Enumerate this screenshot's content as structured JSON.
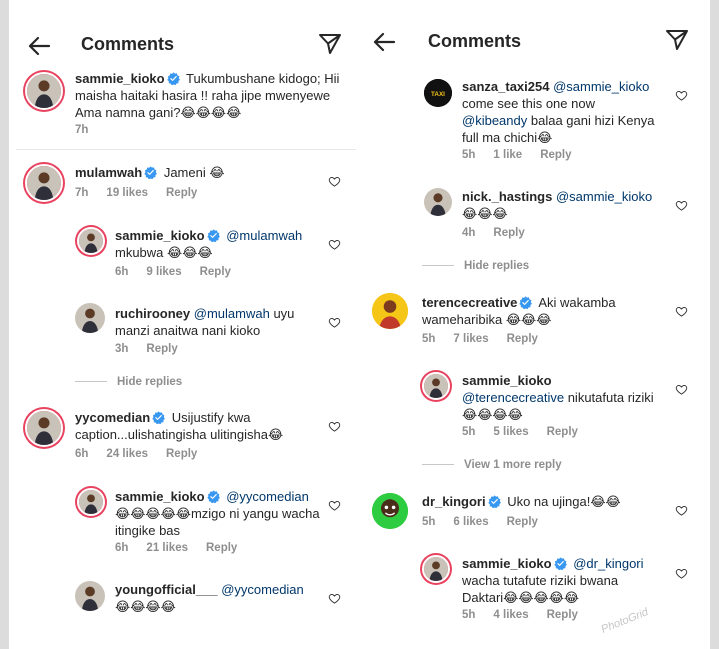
{
  "left": {
    "title": "Comments",
    "comments": [
      {
        "user": "sammie_kioko",
        "text": "Tukumbushane kidogo; Hii maisha haitaki hasira !! raha jipe mwenyewe Ama namna gani?😂😂😂😂",
        "time": "7h"
      },
      {
        "user": "mulamwah",
        "text": "Jameni 😂",
        "time": "7h",
        "likes": "19 likes",
        "reply": "Reply"
      },
      {
        "user": "sammie_kioko",
        "mention": "@mulamwah",
        "text": "mkubwa 😂😂😂",
        "time": "6h",
        "likes": "9 likes",
        "reply": "Reply"
      },
      {
        "user": "ruchirooney",
        "mention": "@mulamwah",
        "text": "uyu manzi anaitwa nani kioko",
        "time": "3h",
        "reply": "Reply"
      },
      {
        "hide": "Hide replies"
      },
      {
        "user": "yycomedian",
        "text": "Usijustify kwa caption...ulishatingisha ulitingisha😂",
        "time": "6h",
        "likes": "24 likes",
        "reply": "Reply"
      },
      {
        "user": "sammie_kioko",
        "mention": "@yycomedian",
        "text": "😂😂😂😂😂mzigo ni yangu wacha itingike bas",
        "time": "6h",
        "likes": "21 likes",
        "reply": "Reply"
      },
      {
        "user": "youngofficial___",
        "mention": "@yycomedian",
        "text": "😂😂😂😂"
      }
    ]
  },
  "right": {
    "title": "Comments",
    "comments": [
      {
        "user": "sanza_taxi254",
        "mention": "@sammie_kioko",
        "text": "come see this one now",
        "mention2": "@kibeandy",
        "text2": "balaa gani hizi Kenya full ma chichi😂",
        "time": "5h",
        "likes": "1 like",
        "reply": "Reply"
      },
      {
        "user": "nick._hastings",
        "mention": "@sammie_kioko",
        "text": "😂😂😂",
        "time": "4h",
        "reply": "Reply"
      },
      {
        "hide": "Hide replies"
      },
      {
        "user": "terencecreative",
        "text": "Aki wakamba wameharibika 😂😂😂",
        "time": "5h",
        "likes": "7 likes",
        "reply": "Reply"
      },
      {
        "user": "sammie_kioko",
        "mention": "@terencecreative",
        "text": "nikutafuta riziki😂😂😂😂",
        "time": "5h",
        "likes": "5 likes",
        "reply": "Reply"
      },
      {
        "more": "View 1 more reply"
      },
      {
        "user": "dr_kingori",
        "text": "Uko na ujinga!😂😂",
        "time": "5h",
        "likes": "6 likes",
        "reply": "Reply"
      },
      {
        "user": "sammie_kioko",
        "mention": "@dr_kingori",
        "text": "wacha tutafute riziki bwana Daktari😂😂😂😂😂",
        "time": "5h",
        "likes": "4 likes",
        "reply": "Reply"
      }
    ]
  },
  "watermark": "PhotoGrid",
  "colors": {
    "mention": "#00376b",
    "ring": "#e8425f",
    "verified": "#3897f0",
    "muted": "#8e8e8e"
  }
}
